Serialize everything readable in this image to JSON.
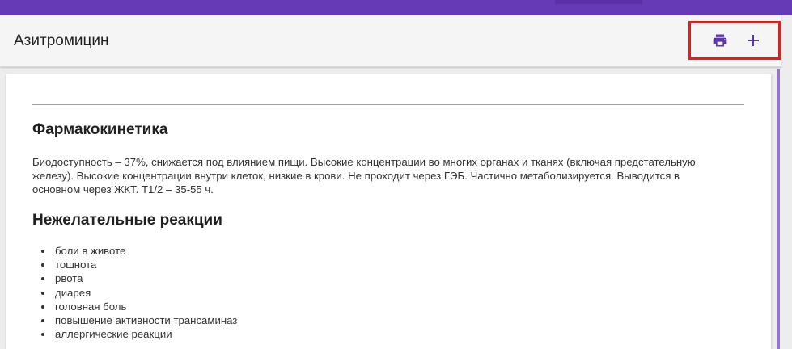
{
  "header": {
    "title": "Азитромицин",
    "actions": {
      "print_icon": "print-icon",
      "add_icon": "plus-icon"
    }
  },
  "colors": {
    "brand": "#6639b7",
    "icon": "#5e35b1",
    "highlight": "#e11d1d"
  },
  "content": {
    "sections": [
      {
        "heading": "Фармакокинетика",
        "text": "Биодоступность – 37%, снижается под влиянием пищи. Высокие концентрации во многих органах и тканях (включая предстательную железу). Высокие концентрации внутри клеток, низкие в крови. Не проходит через ГЭБ. Частично метаболизируется. Выводится в основном через ЖКТ. T1/2 – 35-55 ч."
      },
      {
        "heading": "Нежелательные реакции",
        "items": [
          "боли в животе",
          "тошнота",
          "рвота",
          "диарея",
          "головная боль",
          "повышение активности трансаминаз",
          "аллергические реакции"
        ]
      }
    ]
  }
}
